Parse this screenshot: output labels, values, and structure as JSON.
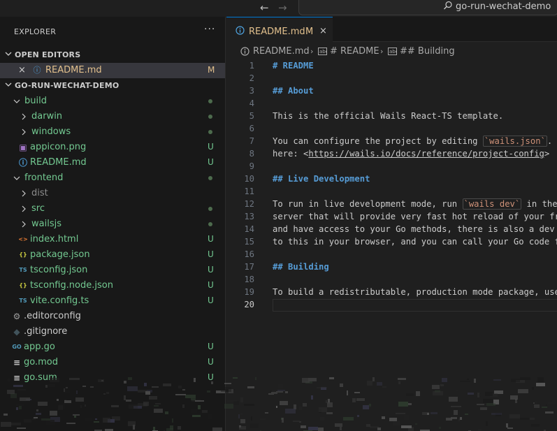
{
  "titlebar": {
    "back_icon": "arrow-left-icon",
    "forward_icon": "arrow-right-icon",
    "search_text": "go-run-wechat-demo"
  },
  "sidebar": {
    "title": "EXPLORER",
    "more": "···",
    "open_editors": {
      "label": "OPEN EDITORS",
      "items": [
        {
          "name": "README.md",
          "badge": "M"
        }
      ]
    },
    "project": {
      "label": "GO-RUN-WECHAT-DEMO",
      "items": [
        {
          "name": "build",
          "type": "folder",
          "expanded": true,
          "depth": 1,
          "status": "dot"
        },
        {
          "name": "darwin",
          "type": "folder",
          "expanded": false,
          "depth": 2,
          "status": "dot"
        },
        {
          "name": "windows",
          "type": "folder",
          "expanded": false,
          "depth": 2,
          "status": "dot"
        },
        {
          "name": "appicon.png",
          "type": "image",
          "depth": 2,
          "badge": "U"
        },
        {
          "name": "README.md",
          "type": "info",
          "depth": 2,
          "badge": "U"
        },
        {
          "name": "frontend",
          "type": "folder",
          "expanded": true,
          "depth": 1,
          "status": "dot"
        },
        {
          "name": "dist",
          "type": "folder",
          "expanded": false,
          "depth": 2,
          "ignored": true
        },
        {
          "name": "src",
          "type": "folder",
          "expanded": false,
          "depth": 2,
          "status": "dot"
        },
        {
          "name": "wailsjs",
          "type": "folder",
          "expanded": false,
          "depth": 2,
          "status": "dot"
        },
        {
          "name": "index.html",
          "type": "html",
          "depth": 2,
          "badge": "U"
        },
        {
          "name": "package.json",
          "type": "json",
          "depth": 2,
          "badge": "U"
        },
        {
          "name": "tsconfig.json",
          "type": "tsconfig",
          "depth": 2,
          "badge": "U"
        },
        {
          "name": "tsconfig.node.json",
          "type": "json",
          "depth": 2,
          "badge": "U"
        },
        {
          "name": "vite.config.ts",
          "type": "ts",
          "depth": 2,
          "badge": "U"
        },
        {
          "name": ".editorconfig",
          "type": "gear",
          "depth": 1,
          "plain": true
        },
        {
          "name": ".gitignore",
          "type": "git",
          "depth": 1,
          "plain": true
        },
        {
          "name": "app.go",
          "type": "go",
          "depth": 1,
          "badge": "U"
        },
        {
          "name": "go.mod",
          "type": "gomod",
          "depth": 1,
          "badge": "U"
        },
        {
          "name": "go.sum",
          "type": "gomod",
          "depth": 1,
          "badge": "U"
        }
      ]
    }
  },
  "editor": {
    "tab": {
      "label": "README.md",
      "badge": "M",
      "close": "×"
    },
    "breadcrumb": [
      "README.md",
      "# README",
      "## Building"
    ],
    "current_line": 20,
    "lines": [
      {
        "n": "1",
        "parts": [
          {
            "t": "# README",
            "c": "hdr"
          }
        ]
      },
      {
        "n": "2",
        "parts": []
      },
      {
        "n": "3",
        "parts": [
          {
            "t": "## About",
            "c": "hdr"
          }
        ]
      },
      {
        "n": "4",
        "parts": []
      },
      {
        "n": "5",
        "parts": [
          {
            "t": "This is the official Wails React-TS template.",
            "c": ""
          }
        ]
      },
      {
        "n": "6",
        "parts": []
      },
      {
        "n": "7",
        "parts": [
          {
            "t": "You can configure the project by editing ",
            "c": ""
          },
          {
            "t": "`wails.json`",
            "c": "codespan"
          },
          {
            "t": ". Mo",
            "c": ""
          }
        ]
      },
      {
        "n": "8",
        "parts": [
          {
            "t": "here: <",
            "c": ""
          },
          {
            "t": "https://wails.io/docs/reference/project-config",
            "c": "link-under"
          },
          {
            "t": ">",
            "c": ""
          }
        ]
      },
      {
        "n": "9",
        "parts": []
      },
      {
        "n": "10",
        "parts": [
          {
            "t": "## Live Development",
            "c": "hdr"
          }
        ]
      },
      {
        "n": "11",
        "parts": []
      },
      {
        "n": "12",
        "parts": [
          {
            "t": "To run in live development mode, run ",
            "c": ""
          },
          {
            "t": "`wails dev`",
            "c": "codespan"
          },
          {
            "t": " in the p",
            "c": ""
          }
        ]
      },
      {
        "n": "13",
        "parts": [
          {
            "t": "server that will provide very fast hot reload of your fro",
            "c": ""
          }
        ]
      },
      {
        "n": "14",
        "parts": [
          {
            "t": "and have access to your Go methods, there is also a dev s",
            "c": ""
          }
        ]
      },
      {
        "n": "15",
        "parts": [
          {
            "t": "to this in your browser, and you can call your Go code fr",
            "c": ""
          }
        ]
      },
      {
        "n": "16",
        "parts": []
      },
      {
        "n": "17",
        "parts": [
          {
            "t": "## Building",
            "c": "hdr"
          }
        ]
      },
      {
        "n": "18",
        "parts": []
      },
      {
        "n": "19",
        "parts": [
          {
            "t": "To build a redistributable, production mode package, use",
            "c": ""
          }
        ]
      },
      {
        "n": "20",
        "parts": []
      }
    ]
  },
  "colors": {
    "accent": "#0078d4",
    "untracked": "#73c991",
    "modified": "#e2c08d",
    "markdown_heading": "#569cd6",
    "inline_code": "#ce9178"
  }
}
